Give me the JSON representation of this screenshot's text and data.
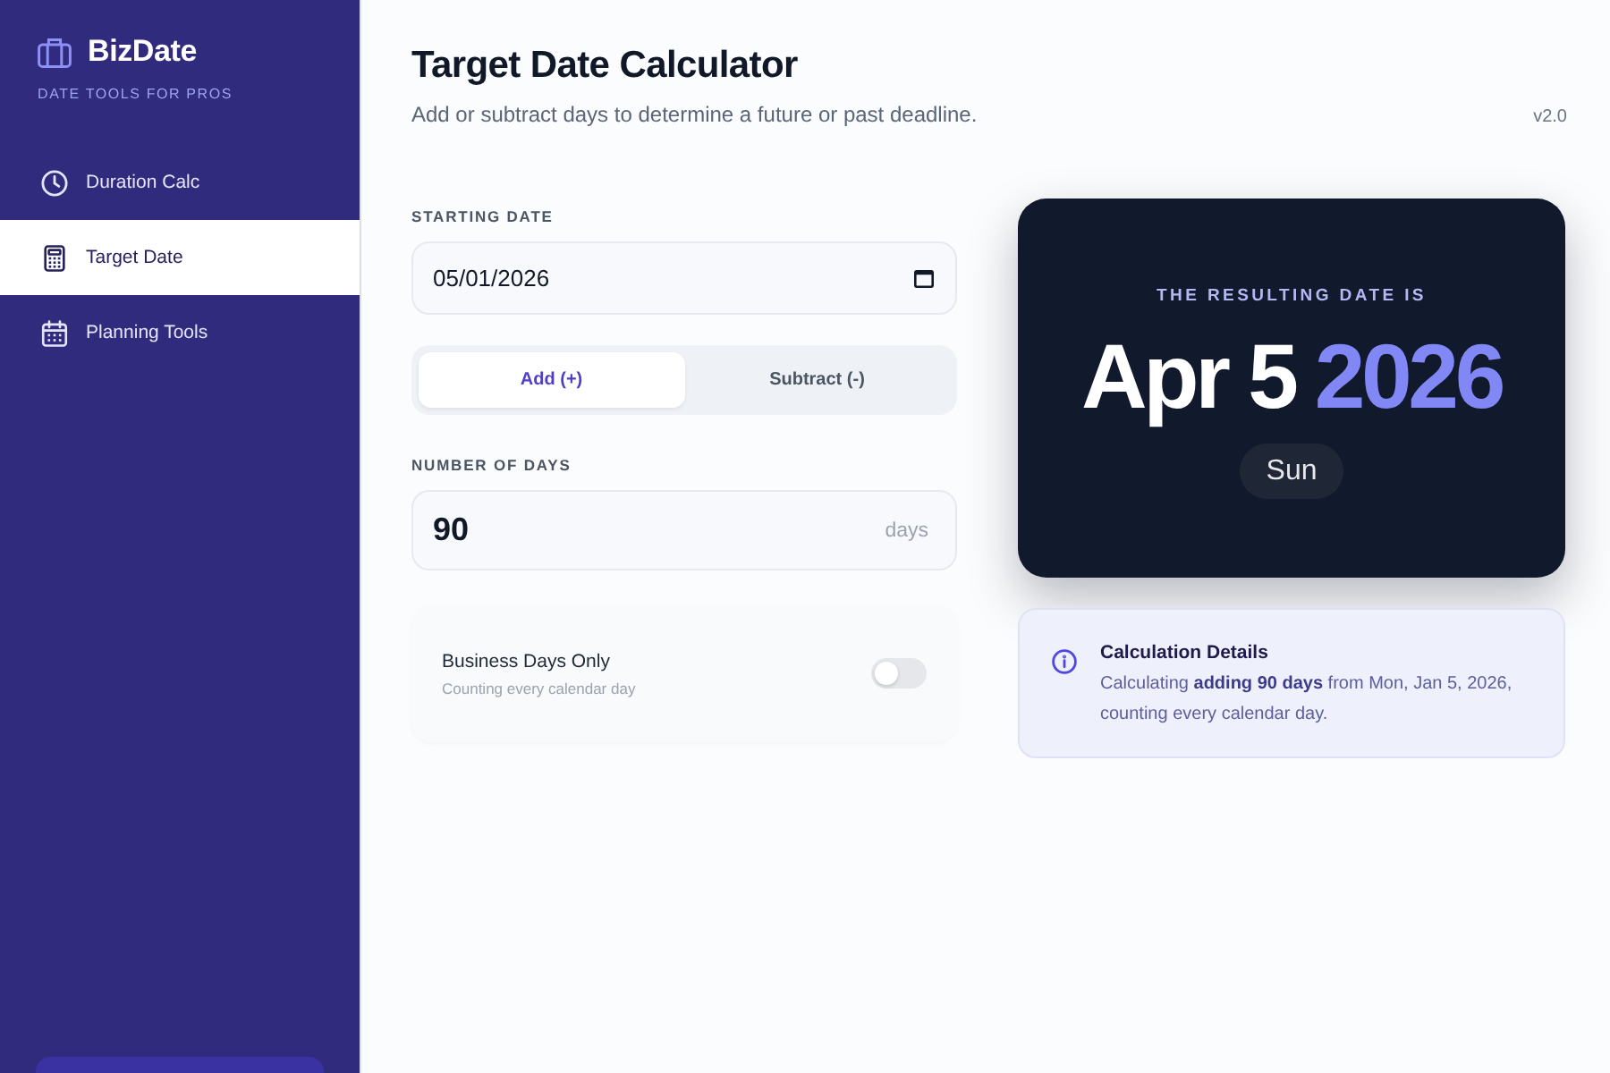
{
  "sidebar": {
    "brand": {
      "name": "BizDate",
      "tagline": "DATE TOOLS FOR PROS"
    },
    "items": [
      {
        "label": "Duration Calc",
        "selected": false
      },
      {
        "label": "Target Date",
        "selected": true
      },
      {
        "label": "Planning Tools",
        "selected": false
      }
    ]
  },
  "header": {
    "title": "Target Date Calculator",
    "subtitle": "Add or subtract days to determine a future or past deadline.",
    "version": "v2.0"
  },
  "form": {
    "start_date": {
      "label": "STARTING DATE",
      "value": "05/01/2026"
    },
    "mode": [
      {
        "label": "Add (+)",
        "selected": true
      },
      {
        "label": "Subtract (-)",
        "selected": false
      }
    ],
    "days": {
      "label": "NUMBER OF DAYS",
      "value": "90",
      "unit": "days"
    },
    "business_days": {
      "label": "Business Days Only",
      "hint": "Counting every calendar day",
      "on": false
    }
  },
  "result": {
    "eyebrow": "THE RESULTING DATE IS",
    "date": "Apr 5",
    "year": "2026",
    "weekday": "Sun"
  },
  "details": {
    "title": "Calculation Details",
    "text": "Calculating **adding 90 days** from Mon, Jan 5, 2026, counting every calendar day."
  }
}
